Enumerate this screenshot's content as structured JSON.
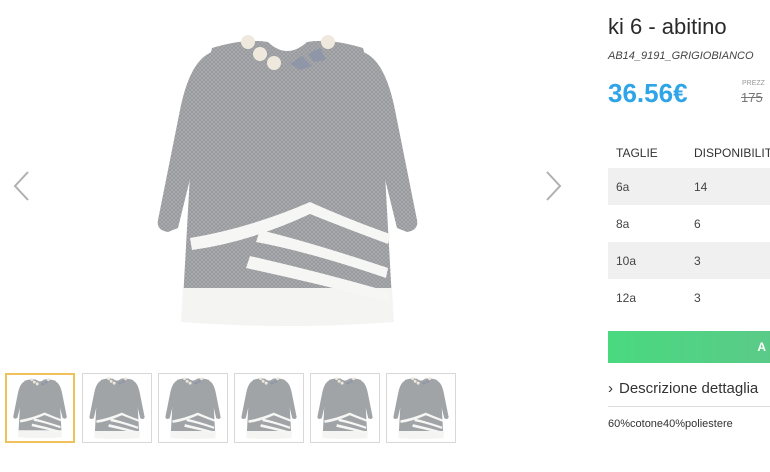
{
  "product": {
    "title": "ki 6 - abitino",
    "sku": "AB14_9191_GRIGIOBIANCO",
    "price": "36.56€",
    "old_price_label": "PREZZ",
    "old_price": "175"
  },
  "gallery": {
    "main_image": "grey-dress-with-white-ruffles",
    "prev_icon": "chevron-left-icon",
    "next_icon": "chevron-right-icon",
    "thumbnails": [
      "thumbnail-1",
      "thumbnail-2",
      "thumbnail-3",
      "thumbnail-4",
      "thumbnail-5",
      "thumbnail-6"
    ],
    "active_thumbnail": 0
  },
  "sizes": {
    "headers": [
      "TAGLIE",
      "DISPONIBILIT"
    ],
    "rows": [
      {
        "size": "6a",
        "qty": "14"
      },
      {
        "size": "8a",
        "qty": "6"
      },
      {
        "size": "10a",
        "qty": "3"
      },
      {
        "size": "12a",
        "qty": "3"
      }
    ]
  },
  "cart": {
    "label": "A"
  },
  "description": {
    "toggle_label": "Descrizione dettaglia",
    "composition": "60%cotone40%poliestere"
  },
  "colors": {
    "price": "#2fa4e7",
    "button": "#49d97f",
    "active_thumb_border": "#f0c05a"
  }
}
